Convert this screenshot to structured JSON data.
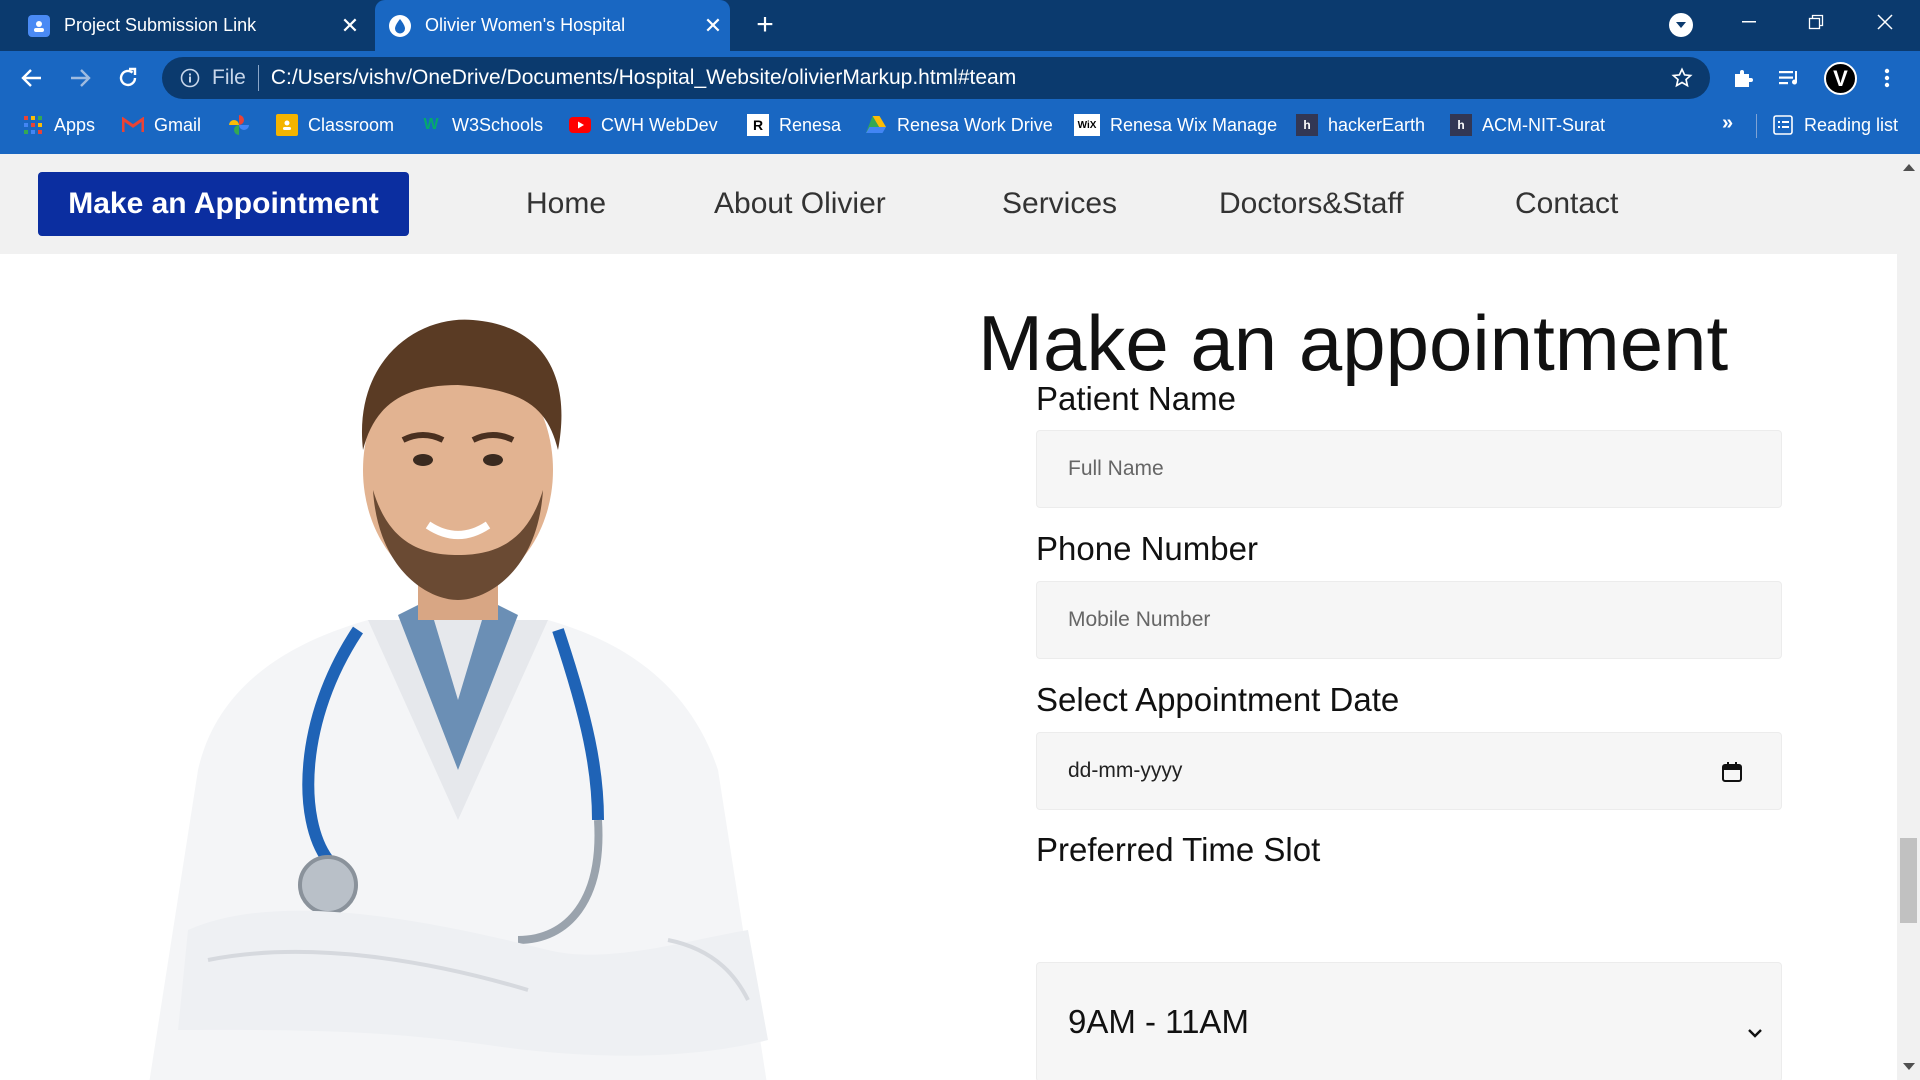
{
  "browser": {
    "tabs": [
      {
        "title": "Project Submission Link",
        "active": false,
        "favicon": "google-classroom-icon"
      },
      {
        "title": "Olivier Women's Hospital",
        "active": true,
        "favicon": "hospital-drop-icon"
      }
    ],
    "new_tab_symbol": "+",
    "url_scheme": "File",
    "url": "C:/Users/vishv/OneDrive/Documents/Hospital_Website/olivierMarkup.html#team",
    "profile_initial": "V",
    "bookmarks": [
      {
        "label": "Apps",
        "icon": "apps-grid-icon"
      },
      {
        "label": "Gmail",
        "icon": "gmail-icon"
      },
      {
        "label": "",
        "icon": "google-photos-icon"
      },
      {
        "label": "Classroom",
        "icon": "classroom-icon"
      },
      {
        "label": "W3Schools",
        "icon": "w3schools-icon"
      },
      {
        "label": "CWH WebDev",
        "icon": "youtube-icon"
      },
      {
        "label": "Renesa",
        "icon": "renesa-icon"
      },
      {
        "label": "Renesa Work Drive",
        "icon": "google-drive-icon"
      },
      {
        "label": "Renesa Wix Manage",
        "icon": "wix-icon"
      },
      {
        "label": "hackerEarth",
        "icon": "hackerearth-icon"
      },
      {
        "label": "ACM-NIT-Surat",
        "icon": "hackerearth-icon"
      }
    ],
    "bookmarks_overflow": "»",
    "reading_list": "Reading list",
    "colors": {
      "tabstrip": "#0b3a6e",
      "toolbar": "#1967c2"
    }
  },
  "site": {
    "cta": "Make an Appointment",
    "nav": [
      "Home",
      "About Olivier",
      "Services",
      "Doctors&Staff",
      "Contact"
    ],
    "colors": {
      "cta": "#0b2ea0",
      "nav_bg": "#f1f1f1"
    }
  },
  "form": {
    "title": "Make an appointment",
    "patient_name": {
      "label": "Patient Name",
      "placeholder": "Full Name"
    },
    "phone": {
      "label": "Phone Number",
      "placeholder": "Mobile Number"
    },
    "date": {
      "label": "Select Appointment Date",
      "value": "dd-mm-yyyy"
    },
    "time_slot": {
      "label": "Preferred Time Slot",
      "selected": "9AM - 11AM"
    }
  }
}
